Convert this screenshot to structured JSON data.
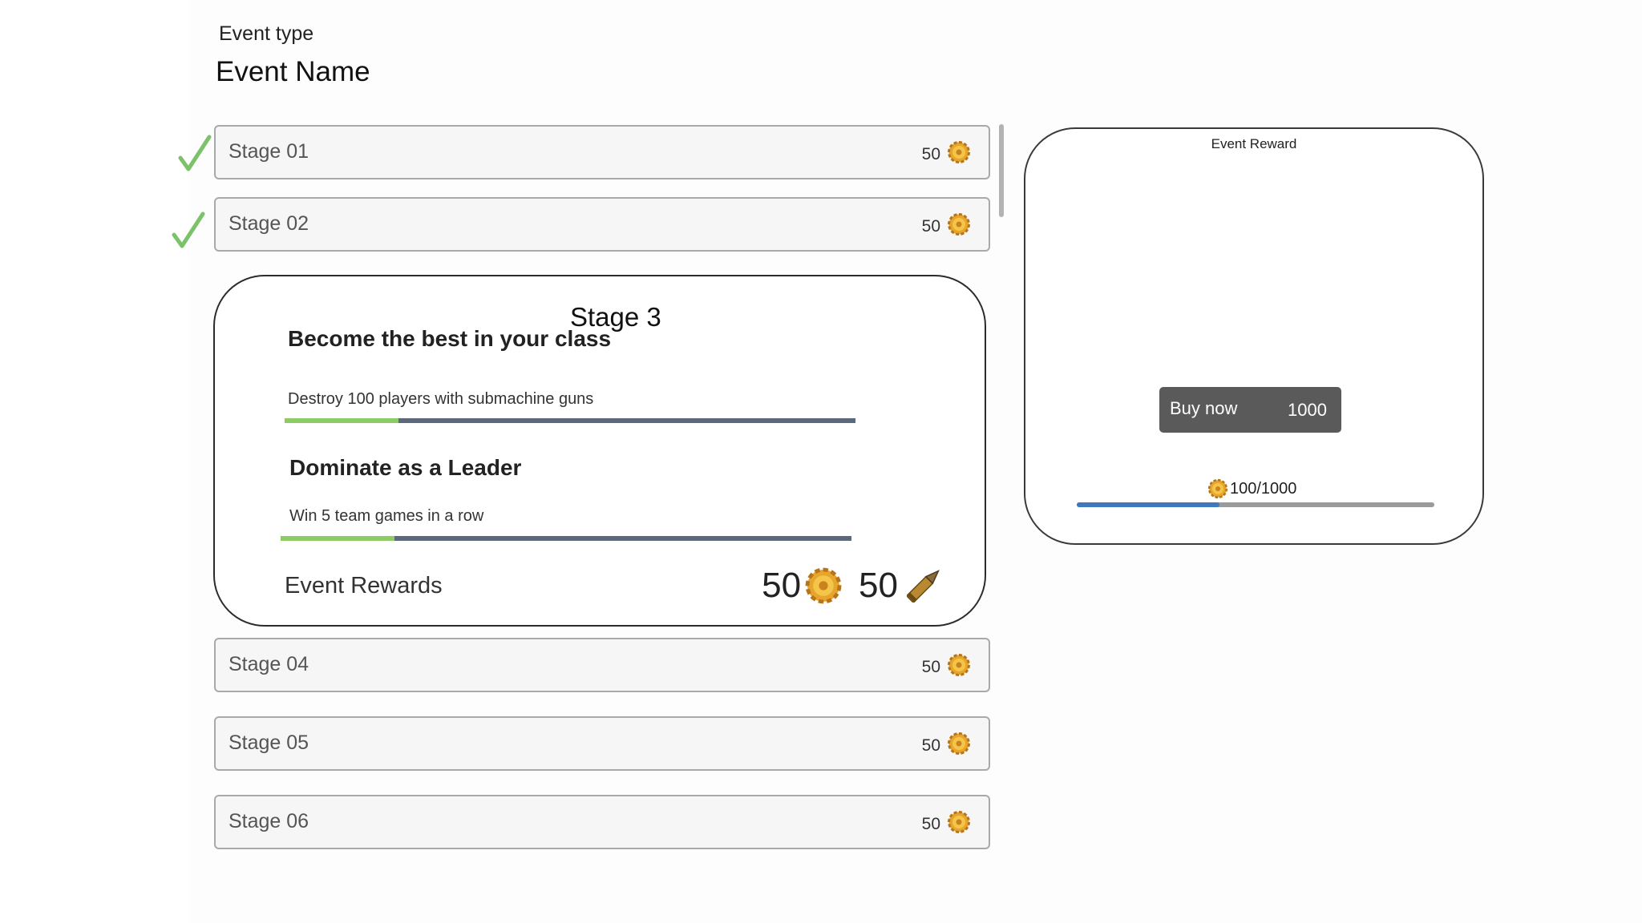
{
  "header": {
    "event_type": "Event type",
    "event_name": "Event Name"
  },
  "stages": [
    {
      "label": "Stage 01",
      "reward": "50",
      "completed": true
    },
    {
      "label": "Stage 02",
      "reward": "50",
      "completed": true
    },
    {
      "label": "Stage 04",
      "reward": "50",
      "completed": false
    },
    {
      "label": "Stage 05",
      "reward": "50",
      "completed": false
    },
    {
      "label": "Stage 06",
      "reward": "50",
      "completed": false
    }
  ],
  "stage3": {
    "title": "Stage 3",
    "quests": [
      {
        "title": "Become the best in your class",
        "description": "Destroy 100 players with submachine guns",
        "progress": 0.2
      },
      {
        "title": "Dominate as a Leader",
        "description": "Win 5 team games in a row",
        "progress": 0.2
      }
    ],
    "rewards_label": "Event Rewards",
    "reward_coins": "50",
    "reward_ammo": "50"
  },
  "event_reward": {
    "title": "Event Reward",
    "buy_label": "Buy now",
    "buy_price": "1000",
    "progress_text": "100/1000",
    "progress": 0.4
  },
  "icons": {
    "completed": "checkmark-icon",
    "coin": "gear-coin-icon",
    "ammo": "bullet-icon"
  },
  "colors": {
    "check": "#7cc26a",
    "quest_fill": "#8ccb66",
    "quest_track": "#5c687c",
    "reward_fill": "#3f78bd",
    "button": "#5a5a5a"
  }
}
